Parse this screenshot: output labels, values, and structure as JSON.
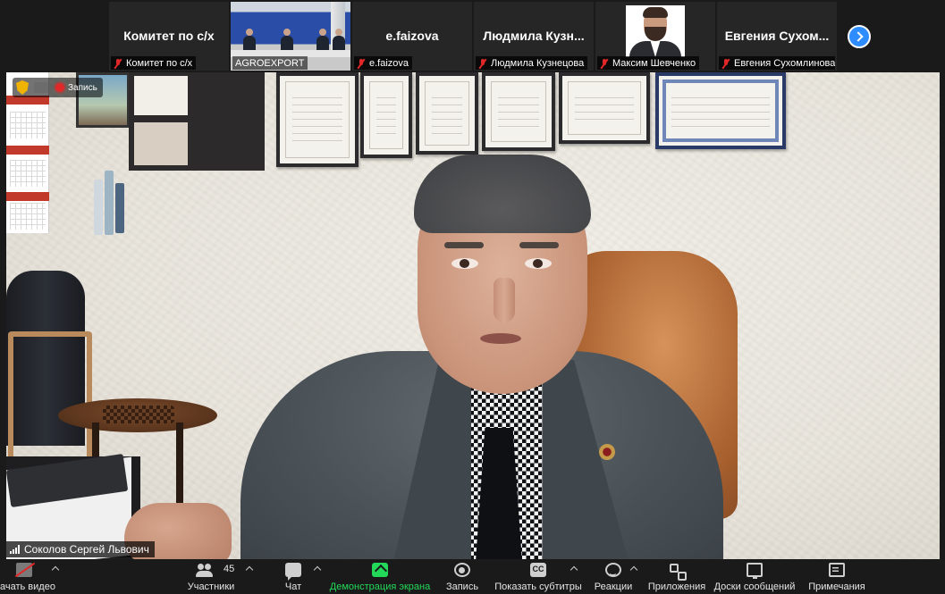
{
  "strip": {
    "tiles": [
      {
        "name": "Комитет по с/х",
        "label": "Комитет по с/х"
      },
      {
        "name": "",
        "label": "AGROEXPORT"
      },
      {
        "name": "e.faizova",
        "label": "e.faizova"
      },
      {
        "name": "Людмила  Кузн...",
        "label": "Людмила Кузнецова"
      },
      {
        "name": "",
        "label": "Максим Шевченко"
      },
      {
        "name": "Евгения  Сухом...",
        "label": "Евгения Сухомлинова..."
      }
    ]
  },
  "video": {
    "recording_label": "Запись",
    "speaker_name": "Соколов Сергей Львович"
  },
  "toolbar": {
    "start_video": "Начать видео",
    "participants": "Участники",
    "participants_count": "45",
    "chat": "Чат",
    "share_screen": "Демонстрация экрана",
    "record": "Запись",
    "captions": "Показать субтитры",
    "captions_badge": "CC",
    "reactions": "Реакции",
    "apps": "Приложения",
    "whiteboards": "Доски сообщений",
    "notes": "Примечания"
  },
  "colors": {
    "accent": "#2d8cff",
    "share_green": "#23d959",
    "muted_red": "#e02828",
    "background": "#1a1a1a"
  }
}
